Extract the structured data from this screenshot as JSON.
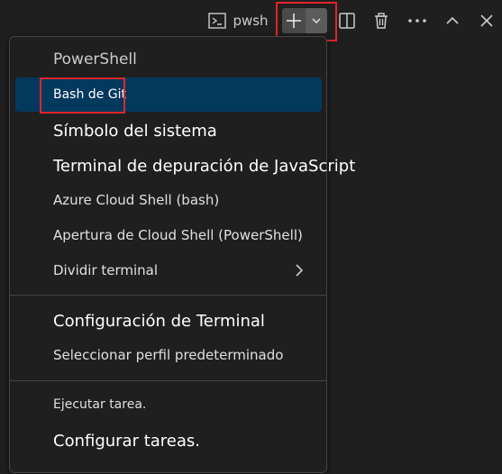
{
  "toolbar": {
    "terminal_label": "pwsh"
  },
  "menu": {
    "items": [
      {
        "label": "PowerShell"
      },
      {
        "label": "Bash de Git"
      },
      {
        "label": "Símbolo del sistema"
      },
      {
        "label": "Terminal de depuración de JavaScript"
      },
      {
        "label": "Azure Cloud Shell (bash)"
      },
      {
        "label": "Apertura de Cloud Shell (PowerShell)"
      },
      {
        "label": "Dividir terminal"
      },
      {
        "label": "Configuración de Terminal"
      },
      {
        "label": "Seleccionar perfil predeterminado"
      },
      {
        "label": "Ejecutar tarea."
      },
      {
        "label": "Configurar tareas."
      }
    ]
  },
  "colors": {
    "background": "#1f1f1f",
    "selected_item": "#04395e",
    "highlight_box": "#e0262a",
    "text": "#cccccc"
  }
}
